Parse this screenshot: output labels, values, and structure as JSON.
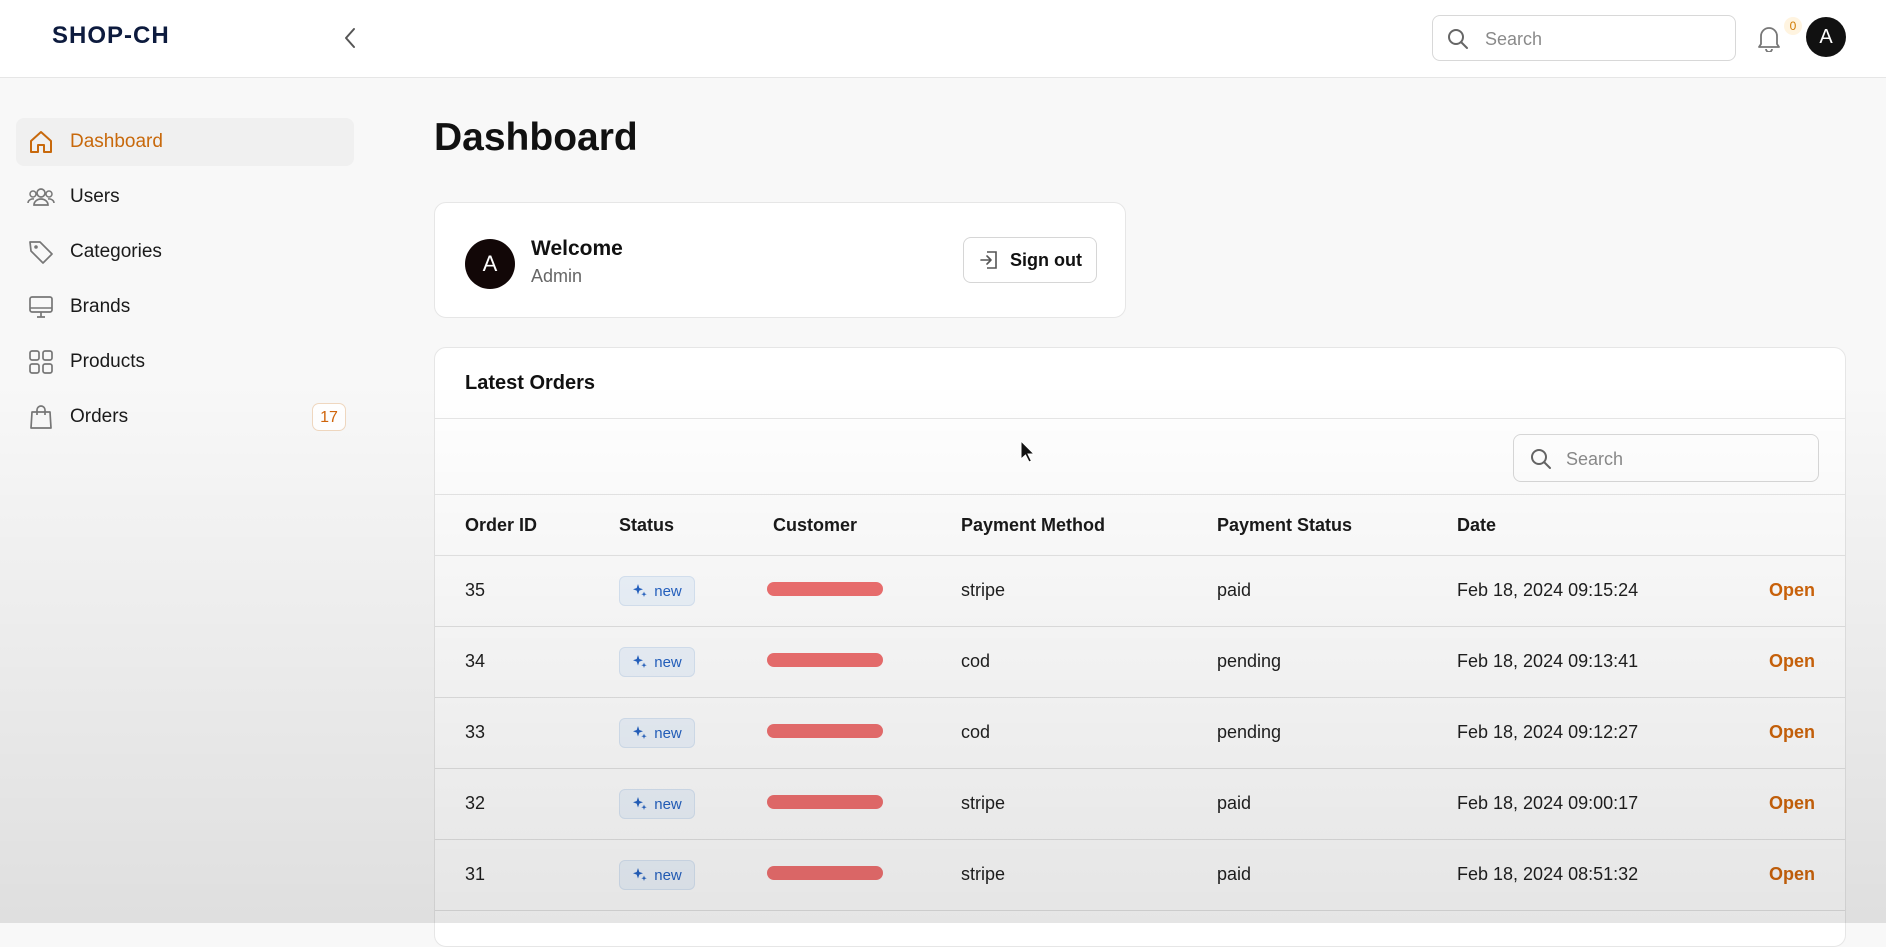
{
  "header": {
    "brand": "SHOP-CH",
    "search_placeholder": "Search",
    "notifications_count": "0",
    "avatar_initial": "A"
  },
  "sidebar": {
    "items": [
      {
        "label": "Dashboard",
        "icon": "home-icon",
        "active": true
      },
      {
        "label": "Users",
        "icon": "users-icon"
      },
      {
        "label": "Categories",
        "icon": "tag-icon"
      },
      {
        "label": "Brands",
        "icon": "monitor-icon"
      },
      {
        "label": "Products",
        "icon": "grid-icon"
      },
      {
        "label": "Orders",
        "icon": "shopping-bag-icon",
        "badge": "17"
      }
    ]
  },
  "main": {
    "page_title": "Dashboard",
    "welcome": {
      "avatar_initial": "A",
      "title": "Welcome",
      "role": "Admin",
      "signout_label": "Sign out"
    },
    "orders": {
      "title": "Latest Orders",
      "search_placeholder": "Search",
      "columns": [
        "Order ID",
        "Status",
        "Customer",
        "Payment Method",
        "Payment Status",
        "Date"
      ],
      "rows": [
        {
          "id": "35",
          "status": "new",
          "customer": "",
          "payment_method": "stripe",
          "payment_status": "paid",
          "date": "Feb 18, 2024 09:15:24",
          "action": "Open"
        },
        {
          "id": "34",
          "status": "new",
          "customer": "",
          "payment_method": "cod",
          "payment_status": "pending",
          "date": "Feb 18, 2024 09:13:41",
          "action": "Open"
        },
        {
          "id": "33",
          "status": "new",
          "customer": "",
          "payment_method": "cod",
          "payment_status": "pending",
          "date": "Feb 18, 2024 09:12:27",
          "action": "Open"
        },
        {
          "id": "32",
          "status": "new",
          "customer": "",
          "payment_method": "stripe",
          "payment_status": "paid",
          "date": "Feb 18, 2024 09:00:17",
          "action": "Open"
        },
        {
          "id": "31",
          "status": "new",
          "customer": "",
          "payment_method": "stripe",
          "payment_status": "paid",
          "date": "Feb 18, 2024 08:51:32",
          "action": "Open"
        }
      ]
    }
  },
  "colors": {
    "accent": "#d0650a",
    "badge_blue": "#2563c4",
    "redaction": "#f07070"
  }
}
